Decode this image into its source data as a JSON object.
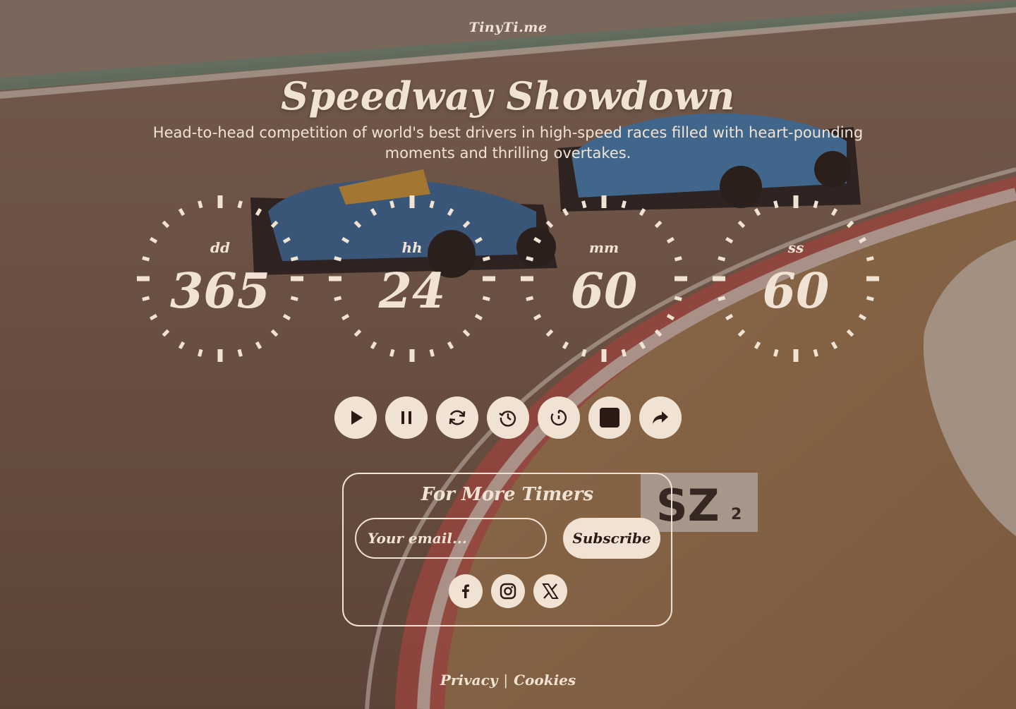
{
  "brand": "TinyTi.me",
  "title": "Speedway Showdown",
  "subtitle": "Head-to-head competition of world's best drivers in high-speed races filled with heart-pounding moments and thrilling overtakes.",
  "countdown": [
    {
      "unit": "dd",
      "value": "365"
    },
    {
      "unit": "hh",
      "value": "24"
    },
    {
      "unit": "mm",
      "value": "60"
    },
    {
      "unit": "ss",
      "value": "60"
    }
  ],
  "controls": [
    {
      "name": "play-button",
      "icon": "play-icon"
    },
    {
      "name": "pause-button",
      "icon": "pause-icon"
    },
    {
      "name": "restart-button",
      "icon": "refresh-icon"
    },
    {
      "name": "history-button",
      "icon": "history-icon"
    },
    {
      "name": "timer-button",
      "icon": "timer-icon"
    },
    {
      "name": "stop-button",
      "icon": "stop-icon"
    },
    {
      "name": "share-button",
      "icon": "share-icon"
    }
  ],
  "subscribe": {
    "heading": "For More Timers",
    "email_placeholder": "Your email...",
    "button_label": "Subscribe"
  },
  "social": [
    "facebook-icon",
    "instagram-icon",
    "x-icon"
  ],
  "footer": {
    "privacy": "Privacy",
    "separator": "|",
    "cookies": "Cookies"
  },
  "colors": {
    "accent": "#f1e3d3",
    "button_icon": "#2a1b17"
  }
}
